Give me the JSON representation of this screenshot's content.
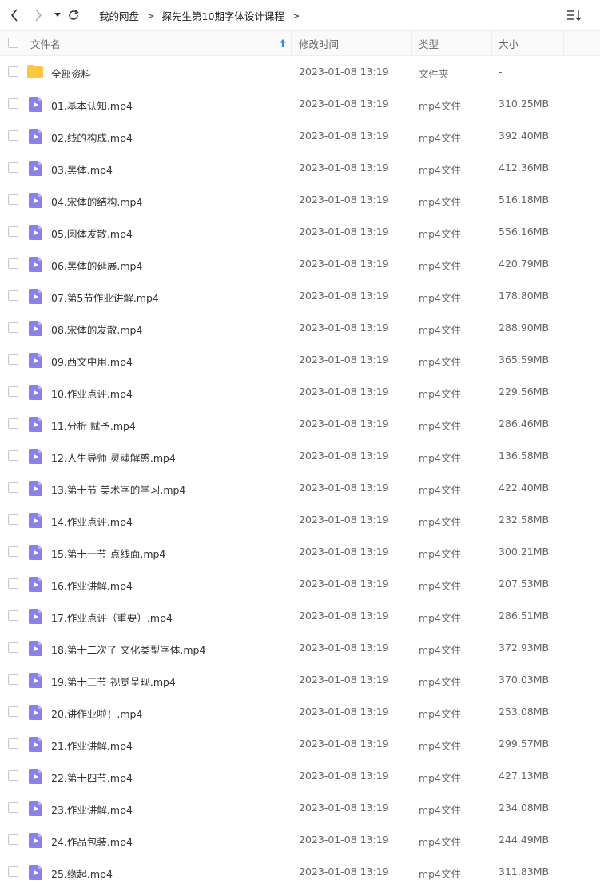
{
  "breadcrumb": [
    "我的网盘",
    "探先生第10期字体设计课程"
  ],
  "breadcrumb_sep": ">",
  "columns": {
    "name": "文件名",
    "modified": "修改时间",
    "type": "类型",
    "size": "大小"
  },
  "accent_color": "#2f8cf0",
  "folder_color": "#fdc743",
  "video_icon_color": "#8b80f0",
  "rows": [
    {
      "name": "全部资料",
      "modified": "2023-01-08 13:19",
      "type": "文件夹",
      "size": "-",
      "icon": "folder-icon"
    },
    {
      "name": "01.基本认知.mp4",
      "modified": "2023-01-08 13:19",
      "type": "mp4文件",
      "size": "310.25MB",
      "icon": "video-file-icon"
    },
    {
      "name": "02.线的构成.mp4",
      "modified": "2023-01-08 13:19",
      "type": "mp4文件",
      "size": "392.40MB",
      "icon": "video-file-icon"
    },
    {
      "name": "03.黑体.mp4",
      "modified": "2023-01-08 13:19",
      "type": "mp4文件",
      "size": "412.36MB",
      "icon": "video-file-icon"
    },
    {
      "name": "04.宋体的结构.mp4",
      "modified": "2023-01-08 13:19",
      "type": "mp4文件",
      "size": "516.18MB",
      "icon": "video-file-icon"
    },
    {
      "name": "05.圆体发散.mp4",
      "modified": "2023-01-08 13:19",
      "type": "mp4文件",
      "size": "556.16MB",
      "icon": "video-file-icon"
    },
    {
      "name": "06.黑体的延展.mp4",
      "modified": "2023-01-08 13:19",
      "type": "mp4文件",
      "size": "420.79MB",
      "icon": "video-file-icon"
    },
    {
      "name": "07.第5节作业讲解.mp4",
      "modified": "2023-01-08 13:19",
      "type": "mp4文件",
      "size": "178.80MB",
      "icon": "video-file-icon"
    },
    {
      "name": "08.宋体的发散.mp4",
      "modified": "2023-01-08 13:19",
      "type": "mp4文件",
      "size": "288.90MB",
      "icon": "video-file-icon"
    },
    {
      "name": "09.西文中用.mp4",
      "modified": "2023-01-08 13:19",
      "type": "mp4文件",
      "size": "365.59MB",
      "icon": "video-file-icon"
    },
    {
      "name": "10.作业点评.mp4",
      "modified": "2023-01-08 13:19",
      "type": "mp4文件",
      "size": "229.56MB",
      "icon": "video-file-icon"
    },
    {
      "name": "11.分析 赋予.mp4",
      "modified": "2023-01-08 13:19",
      "type": "mp4文件",
      "size": "286.46MB",
      "icon": "video-file-icon"
    },
    {
      "name": "12.人生导师 灵魂解惑.mp4",
      "modified": "2023-01-08 13:19",
      "type": "mp4文件",
      "size": "136.58MB",
      "icon": "video-file-icon"
    },
    {
      "name": "13.第十节 美术字的学习.mp4",
      "modified": "2023-01-08 13:19",
      "type": "mp4文件",
      "size": "422.40MB",
      "icon": "video-file-icon"
    },
    {
      "name": "14.作业点评.mp4",
      "modified": "2023-01-08 13:19",
      "type": "mp4文件",
      "size": "232.58MB",
      "icon": "video-file-icon"
    },
    {
      "name": "15.第十一节 点线面.mp4",
      "modified": "2023-01-08 13:19",
      "type": "mp4文件",
      "size": "300.21MB",
      "icon": "video-file-icon"
    },
    {
      "name": "16.作业讲解.mp4",
      "modified": "2023-01-08 13:19",
      "type": "mp4文件",
      "size": "207.53MB",
      "icon": "video-file-icon"
    },
    {
      "name": "17.作业点评（重要）.mp4",
      "modified": "2023-01-08 13:19",
      "type": "mp4文件",
      "size": "286.51MB",
      "icon": "video-file-icon"
    },
    {
      "name": "18.第十二次了 文化类型字体.mp4",
      "modified": "2023-01-08 13:19",
      "type": "mp4文件",
      "size": "372.93MB",
      "icon": "video-file-icon"
    },
    {
      "name": "19.第十三节 视觉呈现.mp4",
      "modified": "2023-01-08 13:19",
      "type": "mp4文件",
      "size": "370.03MB",
      "icon": "video-file-icon"
    },
    {
      "name": "20.讲作业啦！.mp4",
      "modified": "2023-01-08 13:19",
      "type": "mp4文件",
      "size": "253.08MB",
      "icon": "video-file-icon"
    },
    {
      "name": "21.作业讲解.mp4",
      "modified": "2023-01-08 13:19",
      "type": "mp4文件",
      "size": "299.57MB",
      "icon": "video-file-icon"
    },
    {
      "name": "22.第十四节.mp4",
      "modified": "2023-01-08 13:19",
      "type": "mp4文件",
      "size": "427.13MB",
      "icon": "video-file-icon"
    },
    {
      "name": "23.作业讲解.mp4",
      "modified": "2023-01-08 13:19",
      "type": "mp4文件",
      "size": "234.08MB",
      "icon": "video-file-icon"
    },
    {
      "name": "24.作品包装.mp4",
      "modified": "2023-01-08 13:19",
      "type": "mp4文件",
      "size": "244.49MB",
      "icon": "video-file-icon"
    },
    {
      "name": "25.缘起.mp4",
      "modified": "2023-01-08 13:19",
      "type": "mp4文件",
      "size": "311.83MB",
      "icon": "video-file-icon"
    }
  ]
}
